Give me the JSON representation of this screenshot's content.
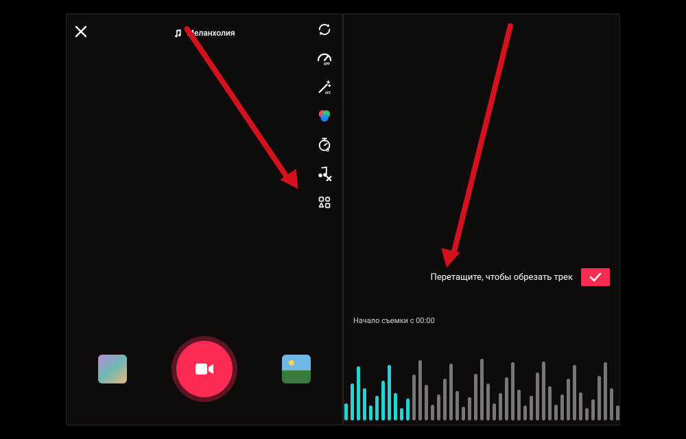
{
  "colors": {
    "accent": "#fe2c55",
    "arrow": "#d3121e",
    "wave_active": "#25d3d3",
    "wave_inactive": "#767676"
  },
  "left": {
    "sound_name": "Меланхолия",
    "tools": [
      {
        "name": "flip-camera-icon"
      },
      {
        "name": "speed-icon"
      },
      {
        "name": "beauty-icon"
      },
      {
        "name": "filters-icon"
      },
      {
        "name": "timer-icon"
      },
      {
        "name": "trim-sound-icon"
      },
      {
        "name": "more-icon"
      }
    ]
  },
  "right": {
    "trim_hint": "Перетащите, чтобы обрезать трек",
    "start_label_prefix": "Начало съемки с",
    "start_time": "00:00"
  }
}
